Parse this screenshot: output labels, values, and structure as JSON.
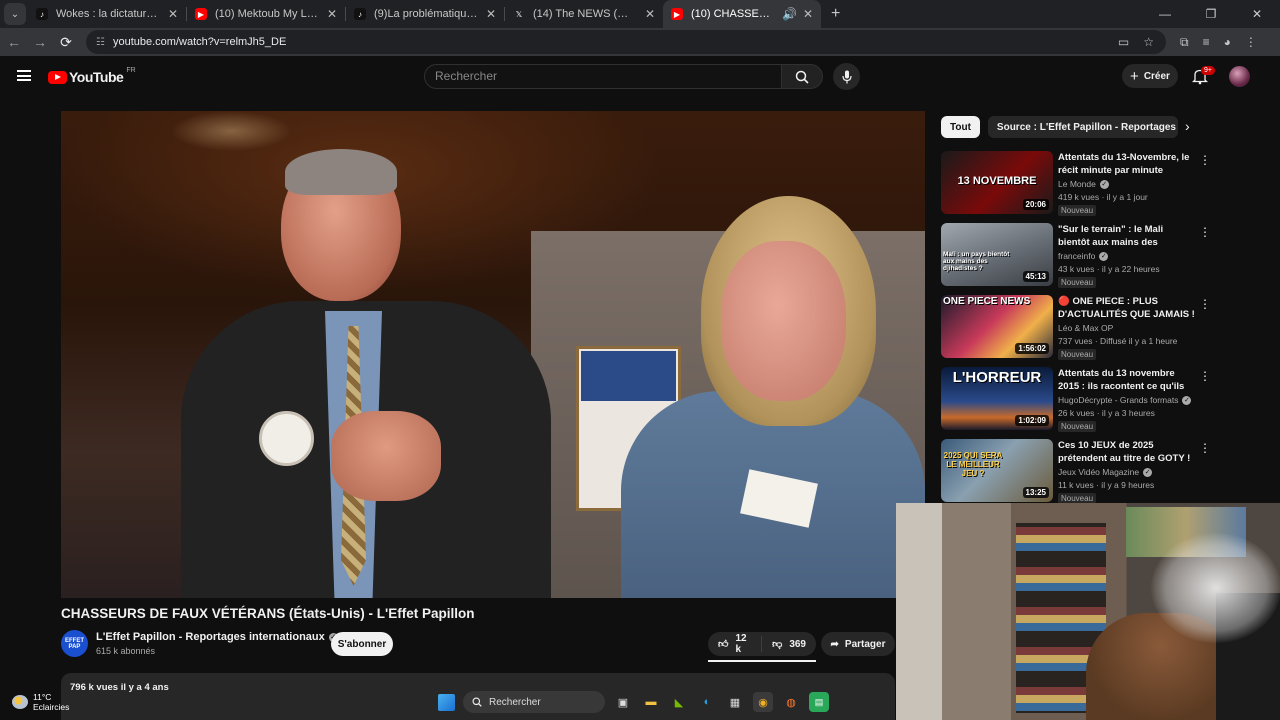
{
  "browser": {
    "tabs": [
      {
        "title": "Wokes : la dictature des bien-pensants",
        "favicon": "tiktok-like-icon",
        "active": false
      },
      {
        "title": "(10) Mektoub My Love : Canto Uno",
        "favicon": "youtube-icon",
        "active": false
      },
      {
        "title": "(9)La problématique raciste dans",
        "favicon": "tiktok-icon",
        "active": false
      },
      {
        "title": "(14) The NEWS (@news_and_trends)",
        "favicon": "x-icon",
        "active": false
      },
      {
        "title": "(10) CHASSEURS DE FAUX VÉTÉRANS",
        "favicon": "youtube-icon",
        "active": true
      }
    ],
    "url": "youtube.com/watch?v=relmJh5_DE"
  },
  "header": {
    "logo_text": "YouTube",
    "country_code": "FR",
    "search_placeholder": "Rechercher",
    "create_label": "Créer",
    "notifications_count": "9+"
  },
  "video": {
    "title": "CHASSEURS DE FAUX VÉTÉRANS (États-Unis) - L'Effet Papillon",
    "channel_name": "L'Effet Papillon - Reportages internationaux",
    "channel_avatar_text": "EFFET PAP",
    "subscribers": "615 k abonnés",
    "subscribe_label": "S'abonner",
    "likes": "12 k",
    "dislikes": "369",
    "share_label": "Partager",
    "views_date": "796 k vues  il y a 4 ans"
  },
  "chips": {
    "all": "Tout",
    "source": "Source : L'Effet Papillon - Reportages internationaux"
  },
  "recommendations": [
    {
      "title": "Attentats du 13-Novembre, le récit minute par minute (Stade...",
      "channel": "Le Monde",
      "meta": "419 k vues · il y a 1 jour",
      "tag": "Nouveau",
      "duration": "20:06",
      "thumb_text": "13 NOVEMBRE"
    },
    {
      "title": "\"Sur le terrain\" : le Mali bientôt aux mains des djihadistes ?",
      "channel": "franceinfo",
      "meta": "43 k vues · il y a 22 heures",
      "tag": "Nouveau",
      "duration": "45:13",
      "thumb_text": "Mali : un pays bientôt aux mains des djihadistes ?"
    },
    {
      "title": "🔴 ONE PIECE : PLUS D'ACTUALITÉS QUE JAMAIS ! -...",
      "channel": "Léo & Max OP",
      "meta": "737 vues · Diffusé il y a 1 heure",
      "tag": "Nouveau",
      "duration": "1:56:02",
      "thumb_text": "ONE PIECE NEWS"
    },
    {
      "title": "Attentats du 13 novembre 2015 : ils racontent ce qu'ils ont vécu",
      "channel": "HugoDécrypte - Grands formats",
      "meta": "26 k vues · il y a 3 heures",
      "tag": "Nouveau",
      "duration": "1:02:09",
      "thumb_text": "L'HORREUR"
    },
    {
      "title": "Ces 10 JEUX de 2025 prétendent au titre de GOTY ! ...",
      "channel": "Jeux Vidéo Magazine",
      "meta": "11 k vues · il y a 9 heures",
      "tag": "Nouveau",
      "duration": "13:25",
      "thumb_text": "2025 QUI SERA LE MEILLEUR JEU ?"
    }
  ],
  "taskbar": {
    "temperature": "11°C",
    "weather": "Eclaircies",
    "search_label": "Rechercher"
  }
}
